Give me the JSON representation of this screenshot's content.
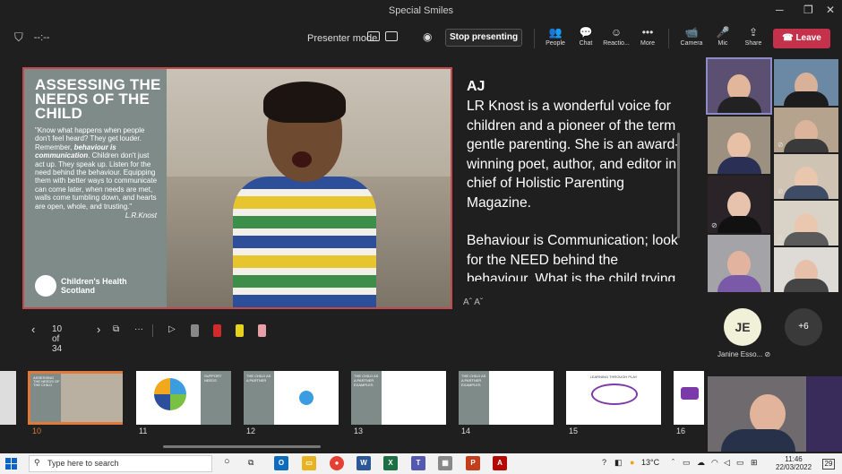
{
  "window": {
    "title": "Special Smiles",
    "timer": "--:--"
  },
  "toolbar": {
    "presenter_mode_label": "Presenter mode",
    "stop_presenting_label": "Stop presenting",
    "people_label": "People",
    "chat_label": "Chat",
    "reactions_label": "Reactio...",
    "more_label": "More",
    "camera_label": "Camera",
    "mic_label": "Mic",
    "share_label": "Share",
    "leave_label": "Leave"
  },
  "slide": {
    "title": "ASSESSING THE NEEDS OF THE CHILD",
    "quote_part1": "\"Know what happens when people don't feel heard? They get louder. Remember, ",
    "quote_emphasis": "behaviour is communication",
    "quote_part2": ". Children don't just act up. They speak up. Listen for the need behind the behaviour. Equipping them with better ways to communicate can come later, when needs are met, walls come tumbling down, and hearts are open, whole, and trusting.\"",
    "author": "L.R.Knost",
    "logo_text": "Children's Health Scotland"
  },
  "notes": {
    "speaker": "AJ",
    "paragraph1": "LR Knost is a wonderful voice for children and a pioneer of the term gentle parenting. She is an award-winning poet, author, and editor in chief of Holistic Parenting Magazine.",
    "paragraph2": "Behaviour is Communication; look for the NEED behind the behaviour. What is the child trying, if the child is trying to",
    "font_controls": "Aˆ Aˇ"
  },
  "nav": {
    "page_indicator": "10 of 34"
  },
  "thumbnails": [
    {
      "num": "10",
      "title": "ASSESSING THE NEEDS OF THE CHILD",
      "selected": true
    },
    {
      "num": "11",
      "title": "SUPPORT NEEDS",
      "selected": false
    },
    {
      "num": "12",
      "title": "THE CHILD AS A PARTNER",
      "selected": false
    },
    {
      "num": "13",
      "title": "THE CHILD AS A PARTNER EXAMPLES",
      "selected": false
    },
    {
      "num": "14",
      "title": "THE CHILD AS A PARTNER EXAMPLES",
      "selected": false
    },
    {
      "num": "15",
      "title": "LEARNING THROUGH PLAY",
      "selected": false
    },
    {
      "num": "16",
      "title": "",
      "selected": false
    }
  ],
  "gallery": {
    "je_initials": "JE",
    "je_name": "Janine Esso...",
    "overflow_count": "+6"
  },
  "taskbar": {
    "search_placeholder": "Type here to search",
    "weather": "13°C",
    "time": "11:46",
    "date": "22/03/2022",
    "notifications": "29"
  },
  "colors": {
    "leave": "#c4314b",
    "slide_border": "#c24a4e",
    "thumb_selected": "#e07a3a"
  }
}
